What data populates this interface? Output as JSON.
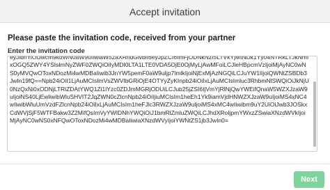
{
  "dialog": {
    "title": "Accept invitation",
    "instruction": "Please paste the invitation code, received from your partner",
    "field_label": "Enter the invitation code",
    "code_value": "eyJlbnYiOiJwcm9kdWN0aW9uIiwiaW52aXRhdGlvbiI6eyJpZCI6ImFjODNkNzI5LTVkYjMtNDk1Yy04NTRkLTJkNmIxOGQ5ZWY4YSIsImNyZWF0ZWQiOiIyMDI0LTA1LTE0VDA5OjE0OjMyLjAwMFoiLCJleHBpcmVzIjoiMjAyNC0wNS0yMVQwOToxNDozMi4wMDBaIiwib3JnYW5pemF0aW9uIjp7ImlkIjoiNjExMjAzNGQiLCJuYW1lIjoiQWNtZSBDb3JwIn19fQ==Npb24iOiI1LjAuMCIsImVsZWVIbGRiOjE4OTYyZyKInpb24iOiIxLjAuMCIsImluc3RhbmNlSWQiOiJkNjU0NzQxNi0xODNjLTRlZDAtYWQ1Zi1lYzc0ZDJmMGRjODUiLCJub25jZSI6IjVmYjRlNjQwYWEifQnaW5WZXJzaW9uIjoiNS40LjEwliwibWluSHVIT2JqZWN0cZlcnNpb24iOiIjiuMCIsIm1heEh1Yk9iamVjdHNWZXJzaW9uIjoiMS4xNC4wIiwibWluUmVzdFZlcnNpb24iOiIxLjAuMCIsIm1heFJlc3RWZXJzaW9uIjoiMS4xMC4wIiwibm9uY2UiOiJwb3JOSkxCdWVjSjF5WTFBakw3Z2MifQsImVyYWIDNhYWQiOiJ1bmRlZmluZWQiLCJhdXRoIjpmYWxzZSwiaXNzdWVkIjoiMjAyNC0wNS0xNFQwOToxNDozMi4wMDBaIiwiaXNzdWVyIjoiYWNtZS1jb3JwIn0=",
    "next_label": "Next"
  }
}
